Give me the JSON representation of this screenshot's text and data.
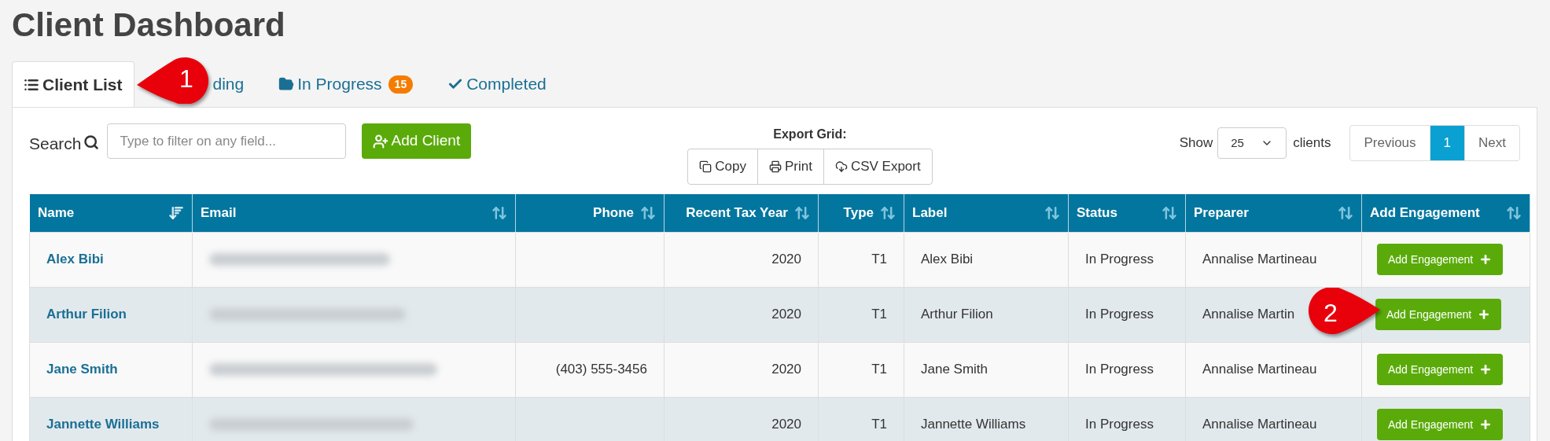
{
  "page": {
    "title": "Client Dashboard"
  },
  "tabs": [
    {
      "label": "Client List",
      "selected": true
    },
    {
      "label": "ding",
      "selected": false
    },
    {
      "label": "In Progress",
      "selected": false,
      "badge": "15"
    },
    {
      "label": "Completed",
      "selected": false
    }
  ],
  "toolbar": {
    "search_label": "Search",
    "search_placeholder": "Type to filter on any field...",
    "add_button": "Add Client",
    "export_label": "Export Grid:",
    "export_buttons": [
      "Copy",
      "Print",
      "CSV Export"
    ],
    "show_label": "Show",
    "page_size": "25",
    "page_size_suffix": "clients",
    "pagination": [
      {
        "label": "Previous",
        "selected": false
      },
      {
        "label": "1",
        "selected": true
      },
      {
        "label": "Next",
        "selected": false
      }
    ]
  },
  "table": {
    "columns": [
      {
        "label": "Name",
        "sorted": true
      },
      {
        "label": "Email",
        "sorted": false
      },
      {
        "label": "Phone",
        "sorted": false
      },
      {
        "label": "Recent Tax Year",
        "sorted": false
      },
      {
        "label": "Type",
        "sorted": false
      },
      {
        "label": "Label",
        "sorted": false
      },
      {
        "label": "Status",
        "sorted": false
      },
      {
        "label": "Preparer",
        "sorted": false
      },
      {
        "label": "Add Engagement",
        "sorted": false
      }
    ],
    "rows": [
      {
        "name": "Alex Bibi",
        "phone": "",
        "year": "2020",
        "type": "T1",
        "label": "Alex Bibi",
        "status": "In Progress",
        "preparer": "Annalise Martineau",
        "action": "Add Engagement"
      },
      {
        "name": "Arthur Filion",
        "phone": "",
        "year": "2020",
        "type": "T1",
        "label": "Arthur Filion",
        "status": "In Progress",
        "preparer": "Annalise Martin",
        "action": "Add Engagement"
      },
      {
        "name": "Jane Smith",
        "phone": "(403) 555-3456",
        "year": "2020",
        "type": "T1",
        "label": "Jane Smith",
        "status": "In Progress",
        "preparer": "Annalise Martineau",
        "action": "Add Engagement"
      },
      {
        "name": "Jannette Williams",
        "phone": "",
        "year": "2020",
        "type": "T1",
        "label": "Jannette Williams",
        "status": "In Progress",
        "preparer": "Annalise Martineau",
        "action": "Add Engagement"
      }
    ]
  },
  "callouts": [
    {
      "number": "1"
    },
    {
      "number": "2"
    }
  ]
}
